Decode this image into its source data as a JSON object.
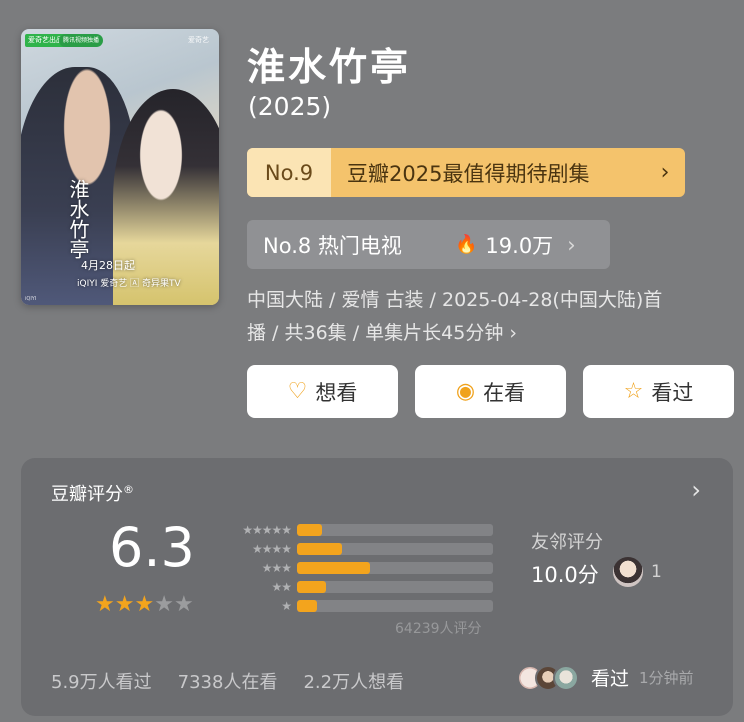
{
  "poster": {
    "badge": "爱奇艺出品",
    "badge2": "腾讯视频独播",
    "logo": "爱奇艺",
    "vertical_title": "淮水竹亭",
    "date": "4月28日起",
    "platforms": "iQIYI 爱奇艺  🄰 奇异果TV",
    "bottom_text": "iQIYI"
  },
  "show": {
    "title": "淮水竹亭",
    "year": "(2025)",
    "rank_gold": {
      "no": "No.9",
      "text": "豆瓣2025最值得期待剧集",
      "chevron": "›"
    },
    "rank_grey": {
      "label": "No.8 热门电视",
      "fire": "🔥",
      "heat": "19.0万",
      "chevron": "›"
    },
    "meta_line1": "中国大陆 / 爱情 古装 / 2025-04-28(中国大陆)首",
    "meta_line2": "播 / 共36集 / 单集片长45分钟 ›"
  },
  "buttons": [
    {
      "label": "想看",
      "icon": "heart-plus-icon",
      "glyph": "♡"
    },
    {
      "label": "在看",
      "icon": "target-icon",
      "glyph": "◉"
    },
    {
      "label": "看过",
      "icon": "star-outline-icon",
      "glyph": "☆"
    }
  ],
  "rating": {
    "title": "豆瓣评分",
    "reg": "®",
    "chevron": "›",
    "score": "6.3",
    "stars_filled": 3,
    "stars_total": 5,
    "distribution": [
      {
        "stars": "★★★★★",
        "fraction": 0.13
      },
      {
        "stars": "★★★★",
        "fraction": 0.23
      },
      {
        "stars": "★★★",
        "fraction": 0.37
      },
      {
        "stars": "★★",
        "fraction": 0.15
      },
      {
        "stars": "★",
        "fraction": 0.1
      }
    ],
    "total": "64239人评分",
    "friend_label": "友邻评分",
    "friend_score": "10.0分",
    "friend_count": "1"
  },
  "counts": {
    "watched": "5.9万人看过",
    "watching": "7338人在看",
    "want": "2.2万人想看"
  },
  "activity": {
    "label": "看过",
    "time": "1分钟前"
  },
  "colors": {
    "background": "#7b7c7e",
    "gold": "#f4c36c",
    "accent": "#f3a41d"
  }
}
